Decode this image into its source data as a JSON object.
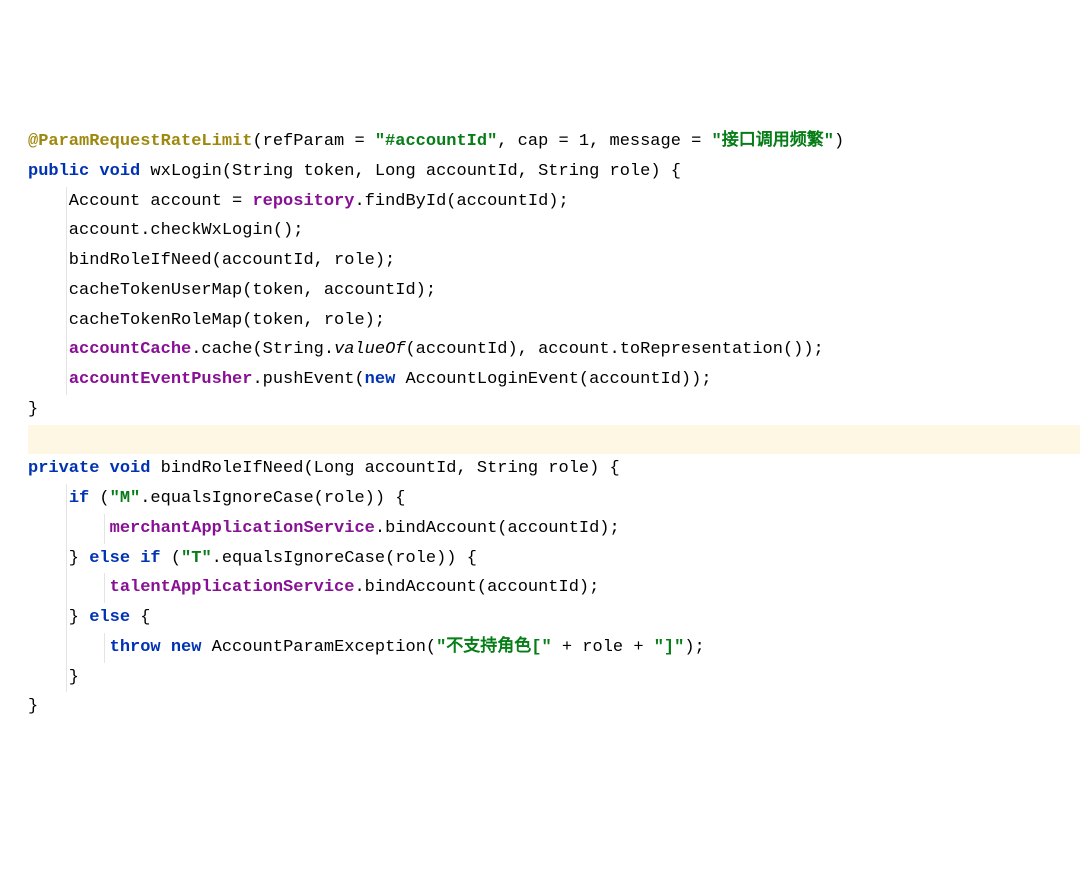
{
  "code": {
    "annotation": "@ParamRequestRateLimit",
    "annParamsOpen": "(refParam = ",
    "annStr1": "\"#accountId\"",
    "annMid": ", cap = 1, message = ",
    "annStr2": "\"接口调用频繁\"",
    "annClose": ")",
    "l1_kw1": "public",
    "l1_kw2": "void",
    "l1_rest": " wxLogin(String token, Long accountId, String role) {",
    "l2_a": "    Account account = ",
    "l2_fld": "repository",
    "l2_b": ".findById(accountId);",
    "l3": "    account.checkWxLogin();",
    "l4": "    bindRoleIfNeed(accountId, role);",
    "l5": "    cacheTokenUserMap(token, accountId);",
    "l6": "    cacheTokenRoleMap(token, role);",
    "l7_pad": "    ",
    "l7_fld": "accountCache",
    "l7_a": ".cache(String.",
    "l7_ital": "valueOf",
    "l7_b": "(accountId), account.toRepresentation());",
    "l8_pad": "    ",
    "l8_fld": "accountEventPusher",
    "l8_a": ".pushEvent(",
    "l8_kw": "new",
    "l8_b": " AccountLoginEvent(accountId));",
    "l9": "}",
    "blank": " ",
    "m1_kw1": "private",
    "m1_kw2": "void",
    "m1_rest": " bindRoleIfNeed(Long accountId, String role) {",
    "m2_pad": "    ",
    "m2_if": "if",
    "m2_a": " (",
    "m2_str": "\"M\"",
    "m2_b": ".equalsIgnoreCase(role)) {",
    "m3_pad": "        ",
    "m3_fld": "merchantApplicationService",
    "m3_b": ".bindAccount(accountId);",
    "m4_pad": "    } ",
    "m4_else": "else",
    "m4_sp": " ",
    "m4_if": "if",
    "m4_a": " (",
    "m4_str": "\"T\"",
    "m4_b": ".equalsIgnoreCase(role)) {",
    "m5_pad": "        ",
    "m5_fld": "talentApplicationService",
    "m5_b": ".bindAccount(accountId);",
    "m6_pad": "    } ",
    "m6_else": "else",
    "m6_b": " {",
    "m7_pad": "        ",
    "m7_throw": "throw",
    "m7_sp": " ",
    "m7_new": "new",
    "m7_a": " AccountParamException(",
    "m7_str1": "\"不支持角色[\"",
    "m7_b": " + role + ",
    "m7_str2": "\"]\"",
    "m7_c": ");",
    "m8": "    }",
    "m9": "}"
  }
}
